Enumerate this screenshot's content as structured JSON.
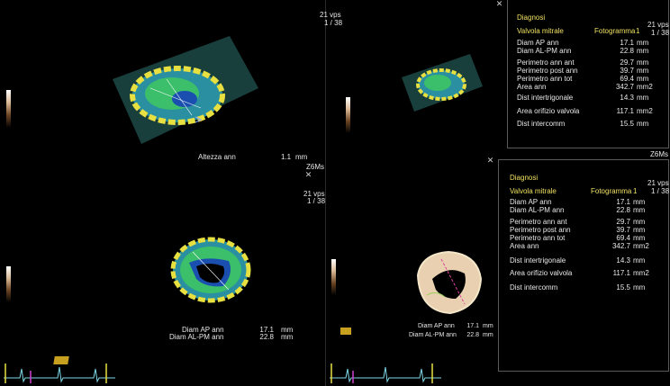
{
  "frame": {
    "rate": "21 vps",
    "counter": "1 / 38"
  },
  "probe": "Z6Ms",
  "viewport_top_left": {
    "label": "Altezza ann",
    "value": "1.1",
    "unit": "mm"
  },
  "viewport_bottom_left": {
    "rows": [
      {
        "label": "Diam AP ann",
        "value": "17.1",
        "unit": "mm"
      },
      {
        "label": "Diam AL-PM ann",
        "value": "22.8",
        "unit": "mm"
      }
    ]
  },
  "viewport_bottom_right": {
    "rows": [
      {
        "label": "Diam AP ann",
        "value": "17.1",
        "unit": "mm"
      },
      {
        "label": "Diam AL-PM ann",
        "value": "22.8",
        "unit": "mm"
      }
    ]
  },
  "report": {
    "title": "Diagnosi",
    "valve": "Valvola mitrale",
    "frame_label": "Fotogramma",
    "frame_value": "1",
    "group1": [
      {
        "label": "Diam AP ann",
        "value": "17.1",
        "unit": "mm"
      },
      {
        "label": "Diam AL-PM ann",
        "value": "22.8",
        "unit": "mm"
      }
    ],
    "group2": [
      {
        "label": "Perimetro ann ant",
        "value": "29.7",
        "unit": "mm"
      },
      {
        "label": "Perimetro post ann",
        "value": "39.7",
        "unit": "mm"
      },
      {
        "label": "Perimetro ann tot",
        "value": "69.4",
        "unit": "mm"
      },
      {
        "label": "Area ann",
        "value": "342.7",
        "unit": "mm2"
      }
    ],
    "group3": [
      {
        "label": "Dist intertrigonale",
        "value": "14.3",
        "unit": "mm"
      }
    ],
    "group4": [
      {
        "label": "Area orifizio valvola",
        "value": "117.1",
        "unit": "mm2"
      }
    ],
    "group5": [
      {
        "label": "Dist intercomm",
        "value": "15.5",
        "unit": "mm"
      }
    ]
  },
  "colors": {
    "panel_title": "#f0e060",
    "ecg": "#7fd8e8",
    "marker": "#d040d0"
  }
}
